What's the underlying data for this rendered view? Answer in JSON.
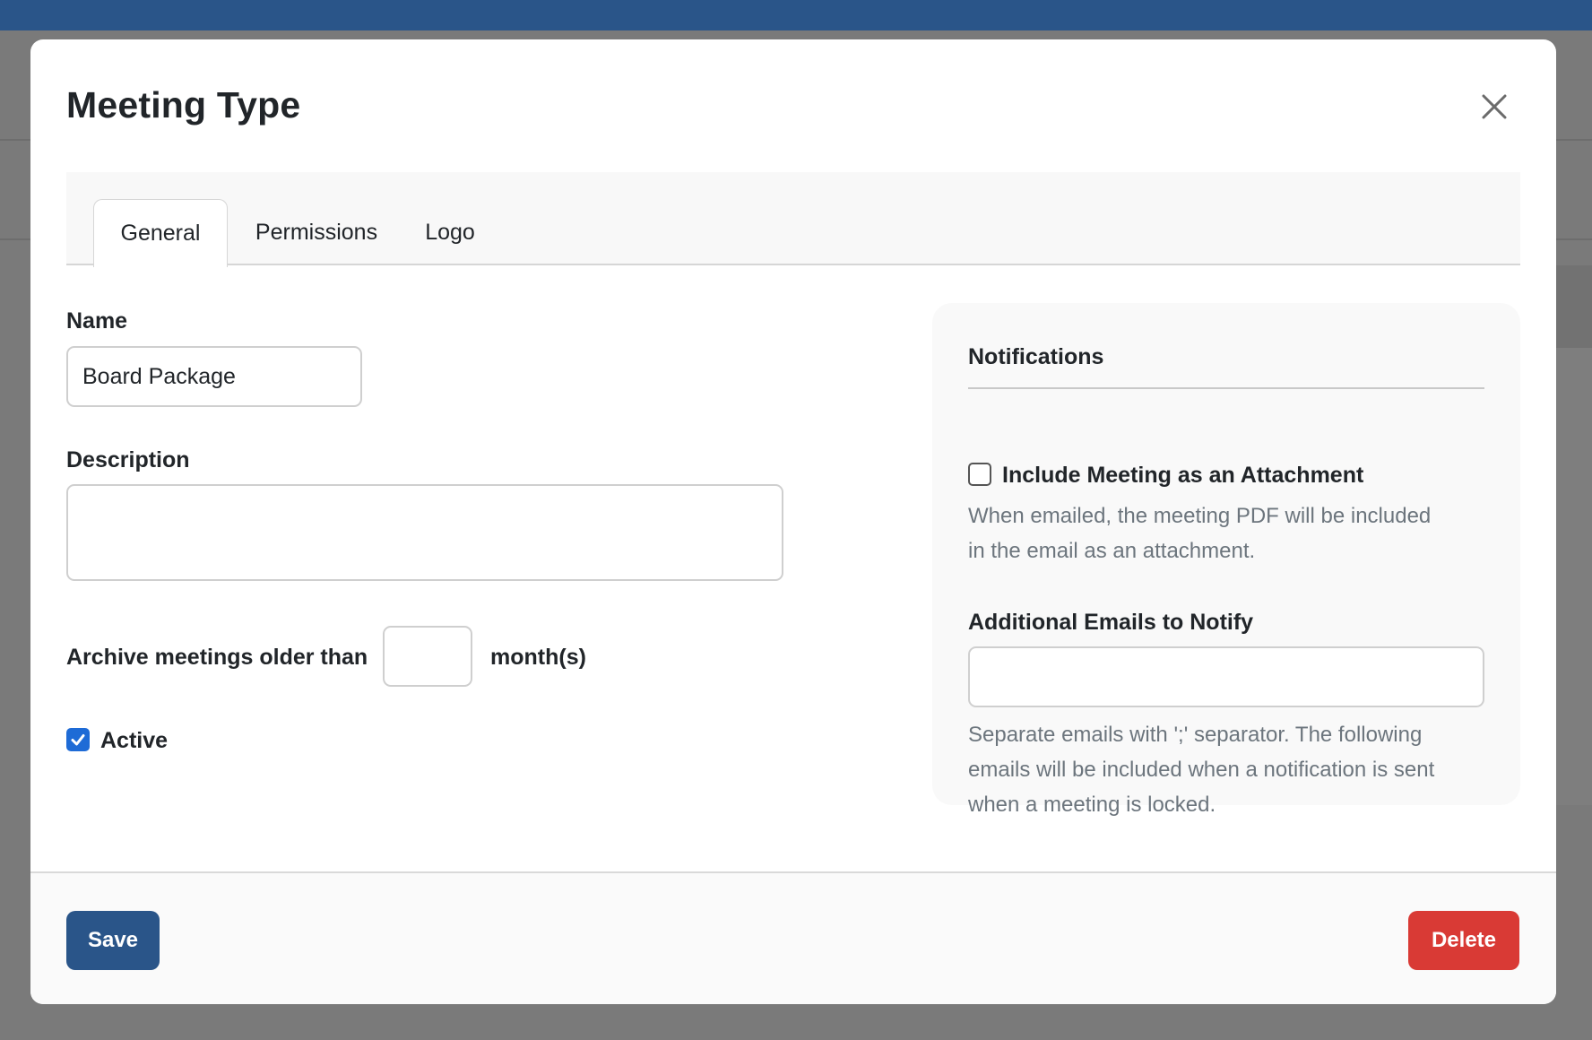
{
  "modal": {
    "title": "Meeting Type"
  },
  "tabs": [
    {
      "label": "General",
      "active": true
    },
    {
      "label": "Permissions",
      "active": false
    },
    {
      "label": "Logo",
      "active": false
    }
  ],
  "general": {
    "name_label": "Name",
    "name_value": "Board Package",
    "description_label": "Description",
    "description_value": "",
    "archive_label": "Archive meetings older than",
    "archive_value": "",
    "archive_unit": "month(s)",
    "active_label": "Active",
    "active_checked": true
  },
  "notifications": {
    "heading": "Notifications",
    "attachment_label": "Include Meeting as an Attachment",
    "attachment_checked": false,
    "attachment_help_line1": "When emailed, the meeting PDF will be included",
    "attachment_help_line2": "in the email as an attachment.",
    "emails_label": "Additional Emails to Notify",
    "emails_value": "",
    "emails_help_line1": "Separate emails with ';' separator. The following",
    "emails_help_line2": "emails will be included when a notification is sent",
    "emails_help_line3": "when a meeting is locked."
  },
  "footer": {
    "save_label": "Save",
    "delete_label": "Delete"
  },
  "colors": {
    "primary": "#2a5589",
    "danger": "#d93a35",
    "checkbox_accent": "#1e6bd6"
  },
  "icons": {
    "close": "close-icon",
    "check": "check-icon"
  }
}
